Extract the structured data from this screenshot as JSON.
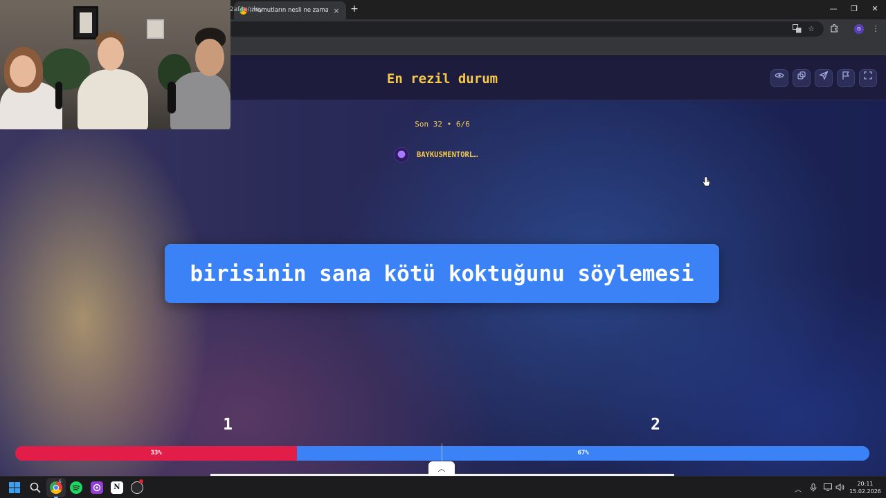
{
  "browser": {
    "tab_title": "mamutların nesli ne zaman tük",
    "tab_close": "×",
    "new_tab": "+",
    "url": "2af4e/play",
    "profile_initial": "G",
    "window_controls": {
      "minimize": "—",
      "restore": "❐",
      "close": "✕"
    },
    "toolbar_icons": [
      "translate-icon",
      "bookmark-star-icon",
      "extensions-icon",
      "profile-icon",
      "menu-icon"
    ]
  },
  "game": {
    "title": "En rezil durum",
    "header_buttons": [
      "eye-icon",
      "share-icon",
      "send-icon",
      "flag-icon",
      "fullscreen-icon"
    ],
    "round_info": "Son 32 • 6/6",
    "creator_name": "BAYKUSMENTORL…",
    "choice_text": "birisinin sana kötü koktuğunu söylemesi",
    "options": [
      {
        "label": "1",
        "percent_text": "33%",
        "percent": 33,
        "color": "#e11d48"
      },
      {
        "label": "2",
        "percent_text": "67%",
        "percent": 67,
        "color": "#3b82f6"
      }
    ],
    "collapse_glyph": "︿"
  },
  "taskbar": {
    "apps": [
      "windows-start-icon",
      "search-icon",
      "chrome-icon",
      "spotify-icon",
      "podcast-app-icon",
      "notion-icon",
      "obs-icon"
    ],
    "chrome_badge": "6",
    "notion_label": "N",
    "time": "20:11",
    "date": "15.02.2026"
  },
  "colors": {
    "accent_yellow": "#f6c94a",
    "card_blue": "#3b82f6",
    "vote_red": "#e11d48"
  }
}
